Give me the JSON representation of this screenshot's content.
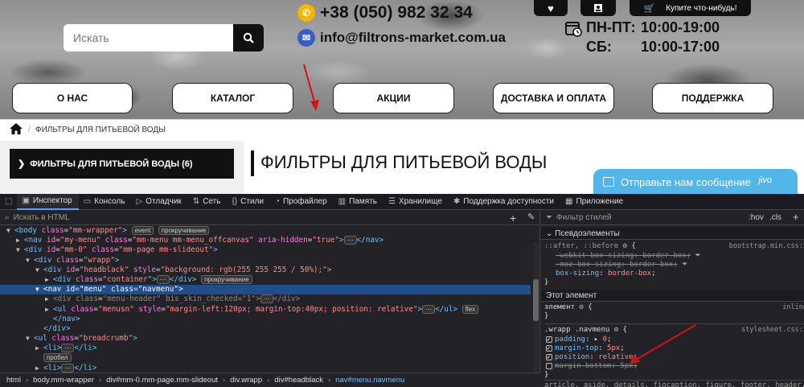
{
  "header": {
    "search_placeholder": "Искать",
    "phone": "+38 (050) 982 32 34",
    "email": "info@filtrons-market.com.ua",
    "cart_label": "Купите что-нибудь!",
    "hours": [
      {
        "days": "ПН-ПТ:",
        "time": "10:00-19:00"
      },
      {
        "days": "СБ:",
        "time": "10:00-17:00"
      }
    ]
  },
  "nav": {
    "items": [
      "О НАС",
      "КАТАЛОГ",
      "АКЦИИ",
      "ДОСТАВКА И ОПЛАТА",
      "ПОДДЕРЖКА"
    ]
  },
  "breadcrumb": {
    "sep": "/",
    "current": "ФИЛЬТРЫ ДЛЯ ПИТЬЕВОЙ ВОДЫ"
  },
  "sidebar": {
    "category": "ФИЛЬТРЫ ДЛЯ ПИТЬЕВОЙ ВОДЫ (6)"
  },
  "page": {
    "title": "ФИЛЬТРЫ ДЛЯ ПИТЬЕВОЙ ВОДЫ"
  },
  "chat": {
    "label": "Отправьте нам сообщение",
    "brand": "jivo"
  },
  "devtools": {
    "tabs": [
      "Инспектор",
      "Консоль",
      "Отладчик",
      "Сеть",
      "Стили",
      "Профайлер",
      "Память",
      "Хранилище",
      "Поддержка доступности",
      "Приложение"
    ],
    "search_placeholder": "Искать в HTML",
    "plus": "+",
    "breadcrumbs": [
      "html",
      "body.mm-wrapper",
      "div#mm-0.mm-page.mm-slideout",
      "div.wrapp",
      "div#headblack",
      "nav#menu.navmenu"
    ],
    "styles": {
      "filter_placeholder": "Фильтр стилей",
      "hov": ":hov",
      "cls": ".cls",
      "pseudo_header": "Псевдоэлементы",
      "pseudo_selector": "::after, ::before",
      "pseudo_source": "bootstrap.min.css:5",
      "pseudo_props": [
        {
          "prop": "-webkit-box-sizing",
          "value": "border-box",
          "struck": true
        },
        {
          "prop": "-moz-box-sizing",
          "value": "border-box",
          "struck": true
        },
        {
          "prop": "box-sizing",
          "value": "border-box",
          "struck": false
        }
      ],
      "element_header": "Этот элемент",
      "element_selector": "элемент",
      "element_source": "inline",
      "rule_selector": ".wrapp .navmenu",
      "rule_source": "stylesheet.css:2",
      "rule_props": [
        {
          "prop": "padding",
          "value": "0",
          "checked": true,
          "struck": false
        },
        {
          "prop": "margin-top",
          "value": "5px",
          "checked": true,
          "struck": false
        },
        {
          "prop": "position",
          "value": "relative",
          "checked": true,
          "struck": false
        },
        {
          "prop": "margin-bottom",
          "value": "5px",
          "checked": false,
          "struck": true
        }
      ],
      "last_selector": "article, aside, details, figcaption, figure, footer, header, hgroup"
    }
  }
}
